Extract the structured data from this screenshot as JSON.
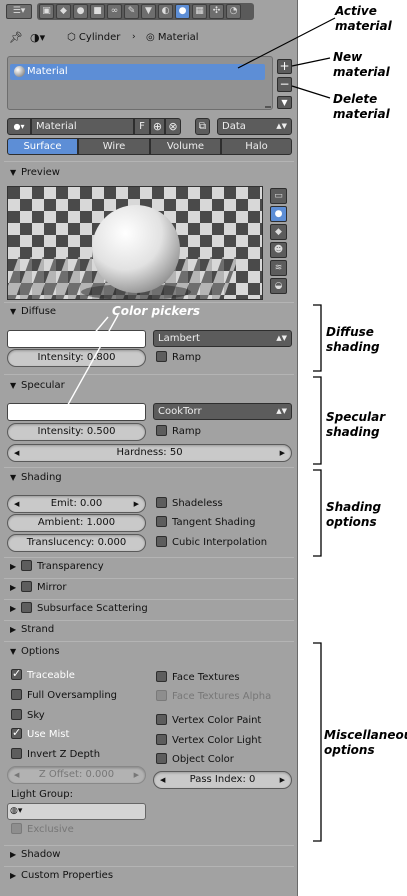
{
  "header": {
    "breadcrumb_object": "Cylinder",
    "breadcrumb_material": "Material"
  },
  "material_slots": {
    "items": [
      "Material"
    ],
    "add_button": "+",
    "remove_button": "−"
  },
  "datablock": {
    "name": "Material",
    "fake_user": "F",
    "link_dropdown": "Data"
  },
  "tabs": [
    "Surface",
    "Wire",
    "Volume",
    "Halo"
  ],
  "preview": {
    "title": "Preview"
  },
  "diffuse": {
    "title": "Diffuse",
    "shader": "Lambert",
    "intensity": "Intensity: 0.800",
    "ramp": "Ramp"
  },
  "specular": {
    "title": "Specular",
    "shader": "CookTorr",
    "intensity": "Intensity: 0.500",
    "ramp": "Ramp",
    "hardness": "Hardness: 50"
  },
  "shading": {
    "title": "Shading",
    "emit": "Emit: 0.00",
    "ambient": "Ambient: 1.000",
    "translucency": "Translucency: 0.000",
    "shadeless": "Shadeless",
    "tangent": "Tangent Shading",
    "cubic": "Cubic Interpolation"
  },
  "collapsed_sections": {
    "transparency": "Transparency",
    "mirror": "Mirror",
    "sss": "Subsurface Scattering",
    "strand": "Strand"
  },
  "options": {
    "title": "Options",
    "traceable": "Traceable",
    "full_oversampling": "Full Oversampling",
    "sky": "Sky",
    "use_mist": "Use Mist",
    "invert_z": "Invert Z Depth",
    "z_offset": "Z Offset: 0.000",
    "light_group_label": "Light Group:",
    "exclusive": "Exclusive",
    "face_textures": "Face Textures",
    "face_textures_alpha": "Face Textures Alpha",
    "vertex_color_paint": "Vertex Color Paint",
    "vertex_color_light": "Vertex Color Light",
    "object_color": "Object Color",
    "pass_index": "Pass Index: 0"
  },
  "bottom_sections": {
    "shadow": "Shadow",
    "custom_properties": "Custom Properties"
  },
  "annotations": {
    "active_material": [
      "Active",
      "material"
    ],
    "new_material": [
      "New",
      "material"
    ],
    "delete_material": [
      "Delete",
      "material"
    ],
    "color_pickers": "Color pickers",
    "diffuse_shading": [
      "Diffuse",
      "shading"
    ],
    "specular_shading": [
      "Specular",
      "shading"
    ],
    "shading_options": [
      "Shading",
      "options"
    ],
    "misc_options": [
      "Miscellaneous",
      "options"
    ]
  },
  "colors": {
    "panel_bg": "#a2a2a2",
    "accent": "#5d8ed6",
    "dark_widget": "#5c5c5c"
  }
}
